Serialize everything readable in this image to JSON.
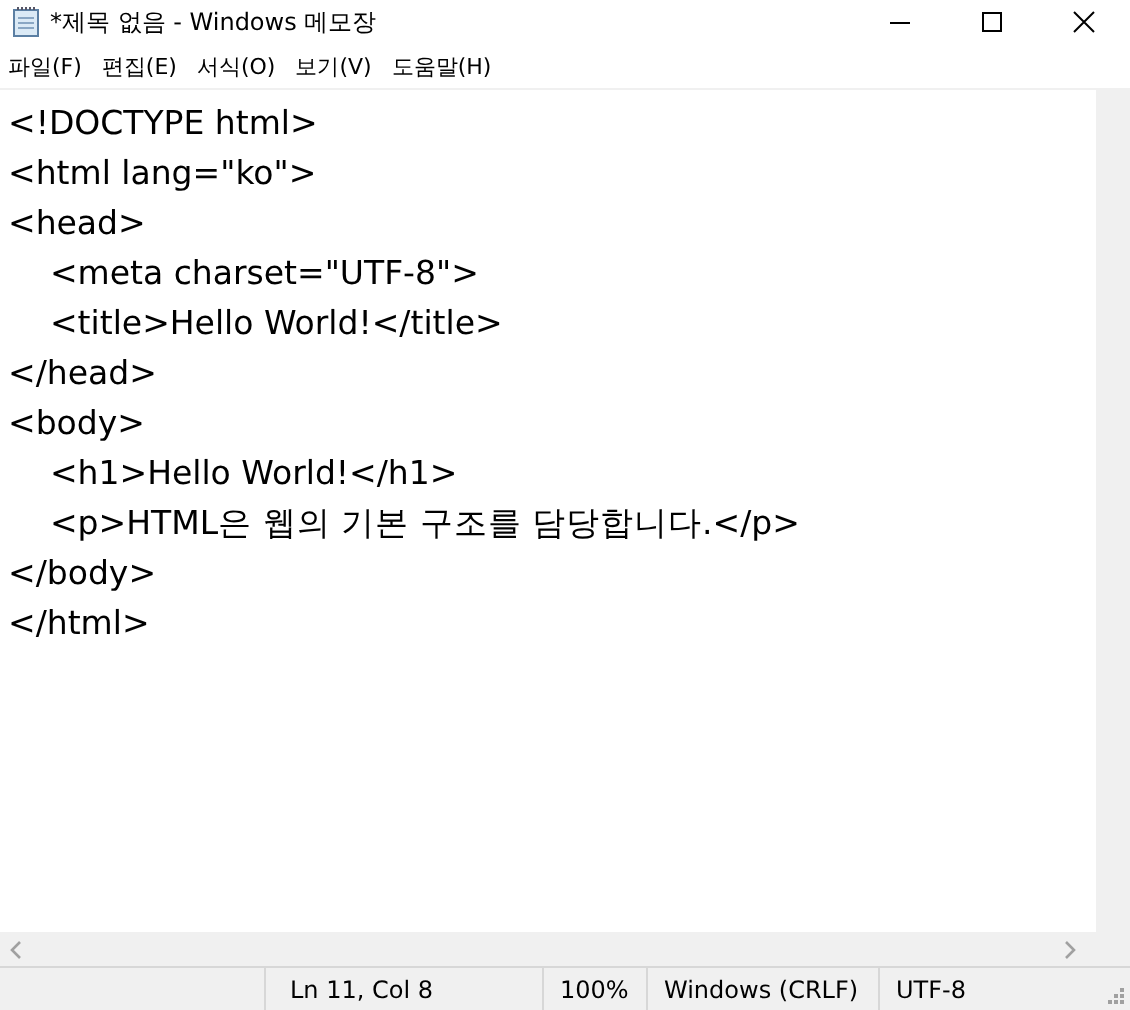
{
  "window": {
    "title": "*제목 없음 - Windows 메모장"
  },
  "menu": [
    "파일(F)",
    "편집(E)",
    "서식(O)",
    "보기(V)",
    "도움말(H)"
  ],
  "editor": {
    "lines": [
      "<!DOCTYPE html>",
      "<html lang=\"ko\">",
      "<head>",
      "    <meta charset=\"UTF-8\">",
      "    <title>Hello World!</title>",
      "</head>",
      "<body>",
      "    <h1>Hello World!</h1>",
      "    <p>HTML은 웹의 기본 구조를 담당합니다.</p>",
      "</body>",
      "</html>"
    ]
  },
  "status_bar": [
    "Ln 11, Col 8",
    "100%",
    "Windows (CRLF)",
    "UTF-8"
  ]
}
